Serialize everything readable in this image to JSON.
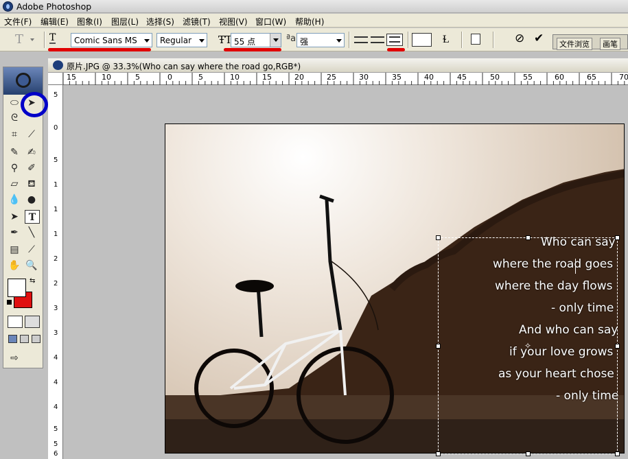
{
  "window": {
    "title": "Adobe Photoshop"
  },
  "menu": [
    "文件(F)",
    "编辑(E)",
    "图象(I)",
    "图层(L)",
    "选择(S)",
    "滤镜(T)",
    "视图(V)",
    "窗口(W)",
    "帮助(H)"
  ],
  "options": {
    "tool_letter": "T",
    "font_family": "Comic Sans MS",
    "font_style": "Regular",
    "font_size": "55 点",
    "aa_label": "a",
    "aa_mode": "强",
    "palette_tabs": [
      "文件浏览",
      "画笔"
    ]
  },
  "document": {
    "title": "原片.JPG @ 33.3%(Who can say  where the road go,RGB*)",
    "ruler_h": [
      "15",
      "10",
      "5",
      "0",
      "5",
      "10",
      "15",
      "20",
      "25",
      "30",
      "35",
      "40",
      "45",
      "50",
      "55",
      "60",
      "65",
      "70"
    ],
    "ruler_v": [
      "5",
      "0",
      "5",
      "1",
      "1",
      "1",
      "2",
      "2",
      "3",
      "3",
      "4",
      "4",
      "4",
      "5",
      "5",
      "6"
    ]
  },
  "text_layer": {
    "lines": [
      "Who can say",
      "where the road goes",
      "where the day flows",
      "- only time",
      "And who can say",
      "if your love grows",
      "as your heart chose",
      "- only time"
    ]
  },
  "colors": {
    "foreground": "#ffffff",
    "background": "#e01010",
    "annotation": "#e00000",
    "highlight_circle": "#0000c8"
  }
}
